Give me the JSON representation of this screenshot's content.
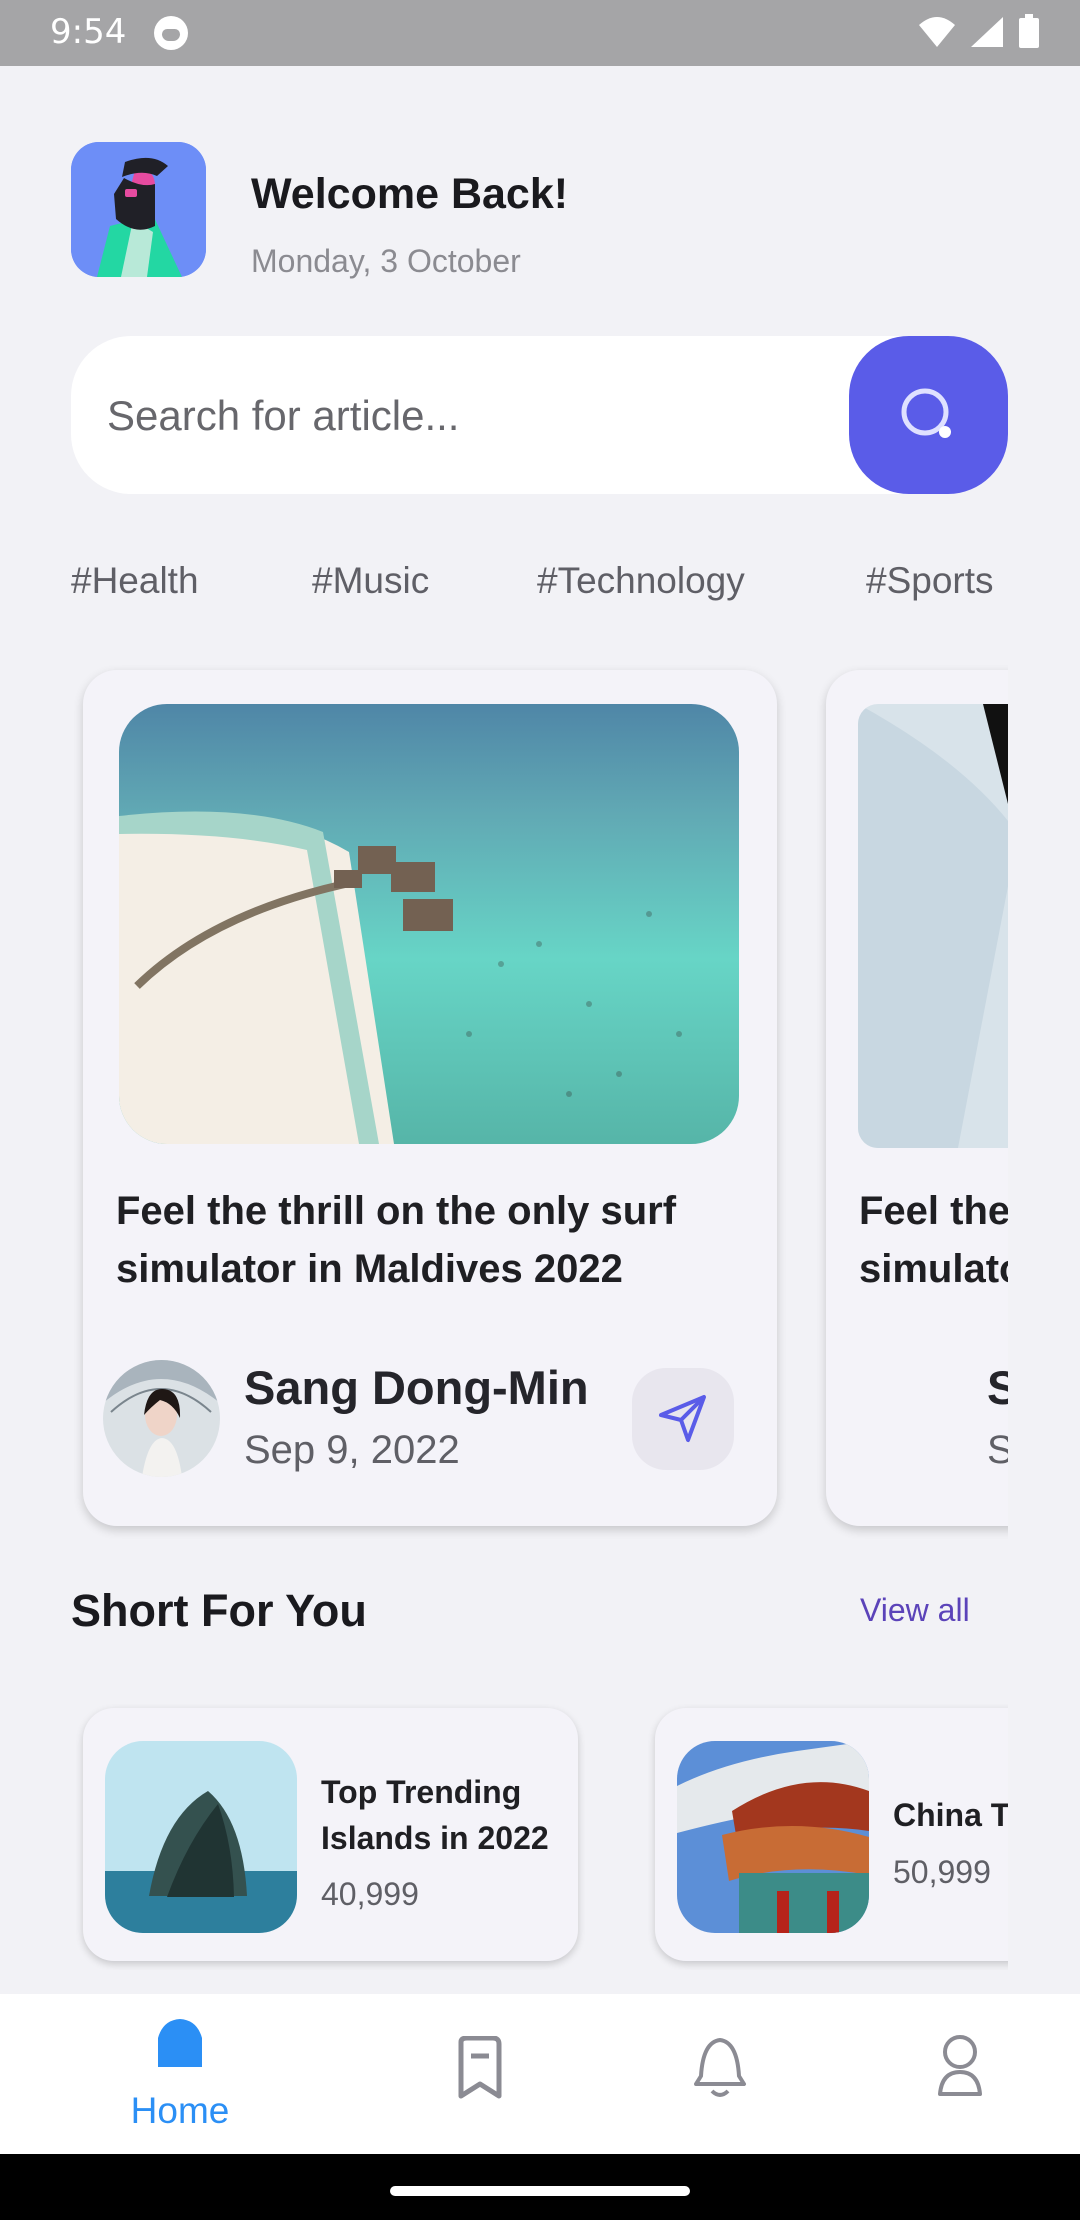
{
  "status_bar": {
    "time": "9:54"
  },
  "header": {
    "welcome": "Welcome Back!",
    "date": "Monday, 3 October"
  },
  "search": {
    "placeholder": "Search for article..."
  },
  "tags": [
    "#Health",
    "#Music",
    "#Technology",
    "#Sports"
  ],
  "articles": [
    {
      "title": "Feel the thrill on the only surf simulator in Maldives 2022",
      "author": "Sang Dong-Min",
      "date": "Sep 9, 2022"
    },
    {
      "title_line1": "Feel the",
      "title_line2": "simulato",
      "author_initial": "S",
      "date_initial": "S"
    }
  ],
  "shorts_section": {
    "title": "Short For You",
    "view_all": "View all"
  },
  "shorts": [
    {
      "title": "Top Trending\nIslands in 2022",
      "count": "40,999"
    },
    {
      "title": "China T",
      "count": "50,999"
    }
  ],
  "bottom_nav": {
    "home_label": "Home",
    "active": "home",
    "active_color": "#2b8ff5"
  },
  "colors": {
    "accent": "#5a5ce8",
    "link": "#5b43b9"
  }
}
